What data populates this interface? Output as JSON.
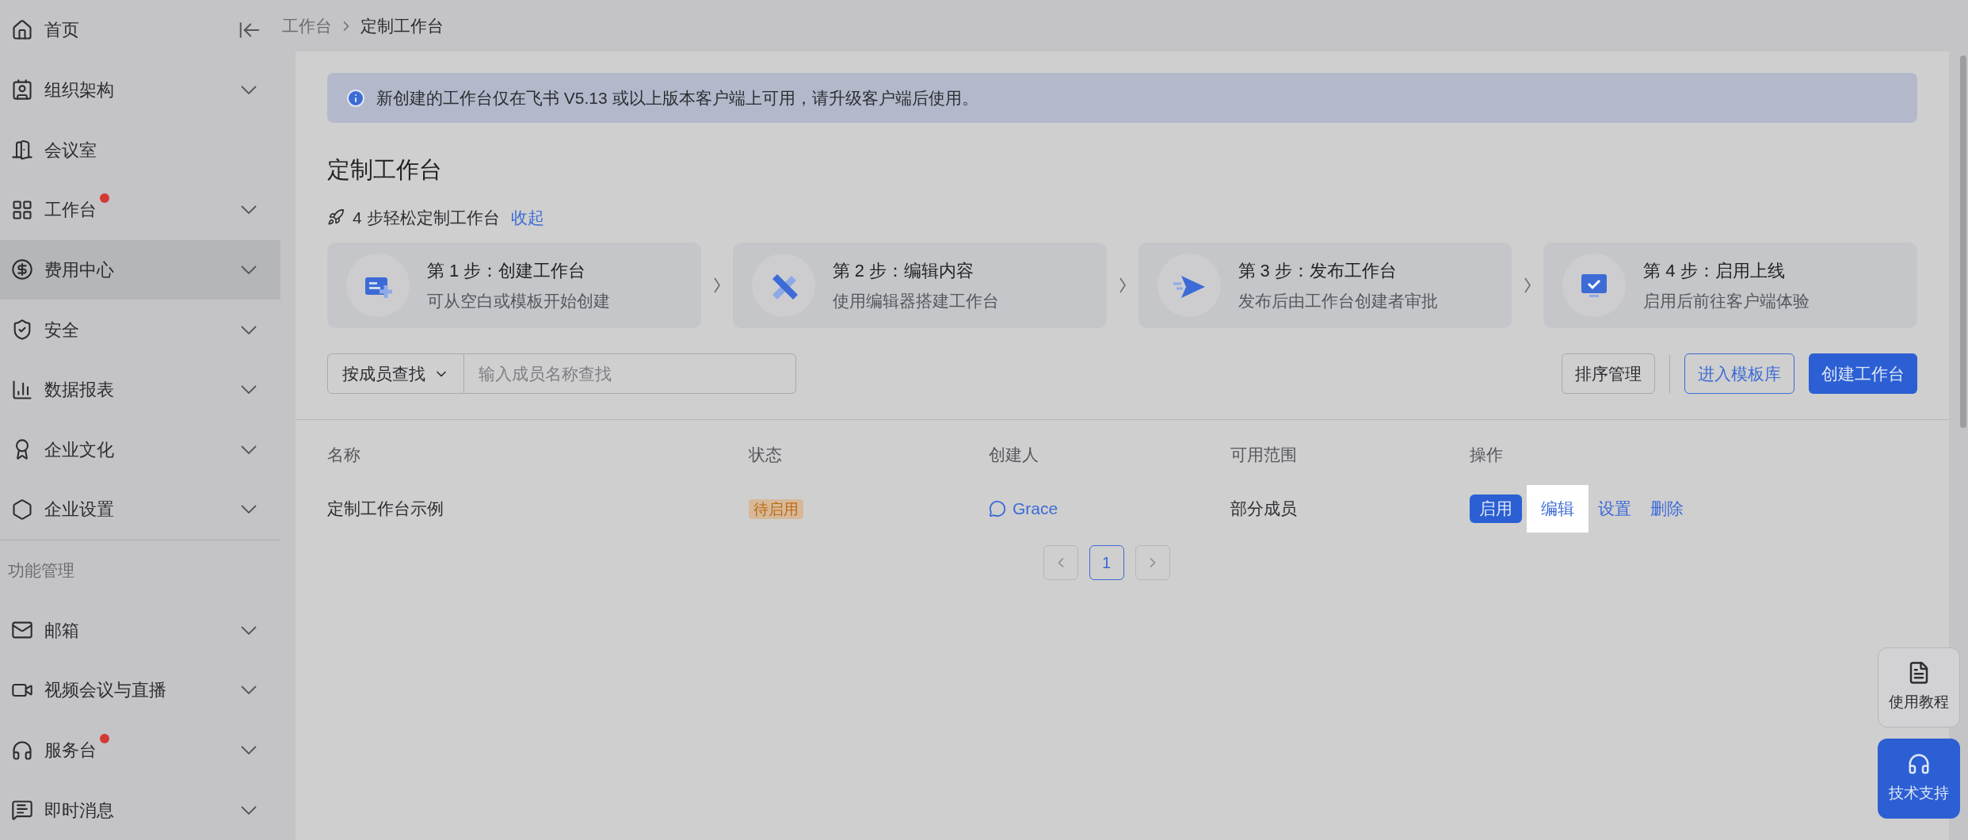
{
  "sidebar": {
    "home": {
      "label": "首页"
    },
    "items": [
      {
        "label": "组织架构",
        "selected": false,
        "dot": false,
        "expandable": true
      },
      {
        "label": "会议室",
        "selected": false,
        "dot": false,
        "expandable": false
      },
      {
        "label": "工作台",
        "selected": false,
        "dot": true,
        "expandable": true
      },
      {
        "label": "费用中心",
        "selected": true,
        "dot": false,
        "expandable": true
      },
      {
        "label": "安全",
        "selected": false,
        "dot": false,
        "expandable": true
      },
      {
        "label": "数据报表",
        "selected": false,
        "dot": false,
        "expandable": true
      },
      {
        "label": "企业文化",
        "selected": false,
        "dot": false,
        "expandable": true
      },
      {
        "label": "企业设置",
        "selected": false,
        "dot": false,
        "expandable": true
      }
    ],
    "section_title": "功能管理",
    "section_items": [
      {
        "label": "邮箱",
        "selected": false,
        "dot": false,
        "expandable": true
      },
      {
        "label": "视频会议与直播",
        "selected": false,
        "dot": false,
        "expandable": true
      },
      {
        "label": "服务台",
        "selected": false,
        "dot": true,
        "expandable": true
      },
      {
        "label": "即时消息",
        "selected": false,
        "dot": false,
        "expandable": true
      }
    ]
  },
  "breadcrumb": [
    {
      "label": "工作台",
      "current": false
    },
    {
      "label": "定制工作台",
      "current": true
    }
  ],
  "notice": "新创建的工作台仅在飞书 V5.13 或以上版本客户端上可用，请升级客户端后使用。",
  "title": "定制工作台",
  "steps_header": {
    "text": "4 步轻松定制工作台",
    "link": "收起"
  },
  "steps": [
    {
      "title": "第 1 步：创建工作台",
      "desc": "可从空白或模板开始创建"
    },
    {
      "title": "第 2 步：编辑内容",
      "desc": "使用编辑器搭建工作台"
    },
    {
      "title": "第 3 步：发布工作台",
      "desc": "发布后由工作台创建者审批"
    },
    {
      "title": "第 4 步：启用上线",
      "desc": "启用后前往客户端体验"
    }
  ],
  "search": {
    "filter": "按成员查找",
    "placeholder": "输入成员名称查找"
  },
  "toolbar": [
    {
      "label": "排序管理",
      "kind": "default"
    },
    {
      "label": "进入模板库",
      "kind": "outline"
    },
    {
      "label": "创建工作台",
      "kind": "primary"
    }
  ],
  "table": {
    "columns": [
      "名称",
      "状态",
      "创建人",
      "可用范围",
      "操作"
    ],
    "rows": [
      {
        "name": "定制工作台示例",
        "status": "待启用",
        "creator": "Grace",
        "scope": "部分成员",
        "actions": [
          {
            "label": "启用",
            "kind": "primary",
            "highlighted": false
          },
          {
            "label": "编辑",
            "kind": "link",
            "highlighted": true
          },
          {
            "label": "设置",
            "kind": "link",
            "highlighted": false
          },
          {
            "label": "删除",
            "kind": "link",
            "highlighted": false
          }
        ]
      }
    ]
  },
  "pagination": [
    {
      "label": "1",
      "selected": true
    }
  ],
  "float_buttons": [
    {
      "label": "使用教程",
      "kind": "default"
    },
    {
      "label": "技术支持",
      "kind": "primary"
    }
  ]
}
